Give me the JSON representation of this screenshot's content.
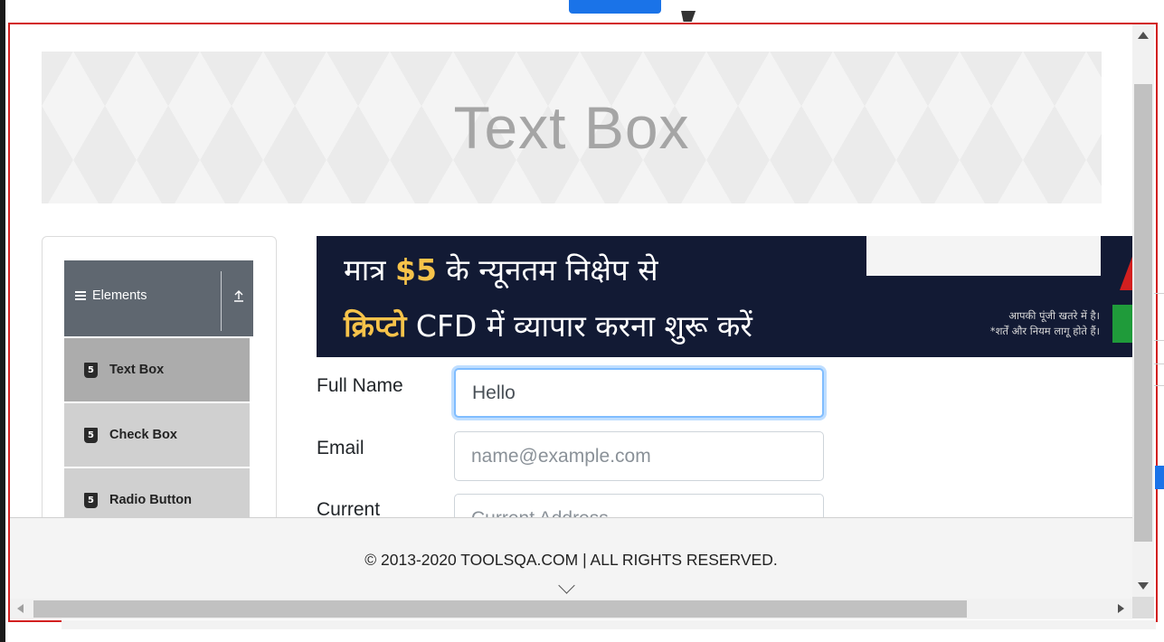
{
  "page": {
    "header_title": "Text Box"
  },
  "sidebar": {
    "group_title": "Elements",
    "items": [
      {
        "label": "Text Box",
        "active": true
      },
      {
        "label": "Check Box",
        "active": false
      },
      {
        "label": "Radio Button",
        "active": false
      }
    ]
  },
  "ad": {
    "line1_pre": "मात्र ",
    "line1_highlight": "$5",
    "line1_post": " के न्यूनतम निक्षेप से",
    "line2_highlight": "क्रिप्टो",
    "line2_post": " CFD में  व्यापार करना शुरू करें",
    "disclaimer_line1": "आपकी पूंजी खतरे में है।",
    "disclaimer_line2": "*शर्तें और नियम लागू होते हैं।"
  },
  "form": {
    "full_name_label": "Full Name",
    "full_name_value": "Hello",
    "email_label": "Email",
    "email_placeholder": "name@example.com",
    "current_address_label": "Current",
    "current_address_placeholder": "Current Address"
  },
  "footer": {
    "text": "© 2013-2020 TOOLSQA.COM | ALL RIGHTS RESERVED."
  },
  "colors": {
    "frame_border": "#d21f1f",
    "group_header": "#5f6770",
    "active_item": "#acacac",
    "inactive_item": "#d0d0d0",
    "focus_ring": "#80bdff",
    "ad_background": "#121a34",
    "ad_highlight": "#f7c34a"
  }
}
